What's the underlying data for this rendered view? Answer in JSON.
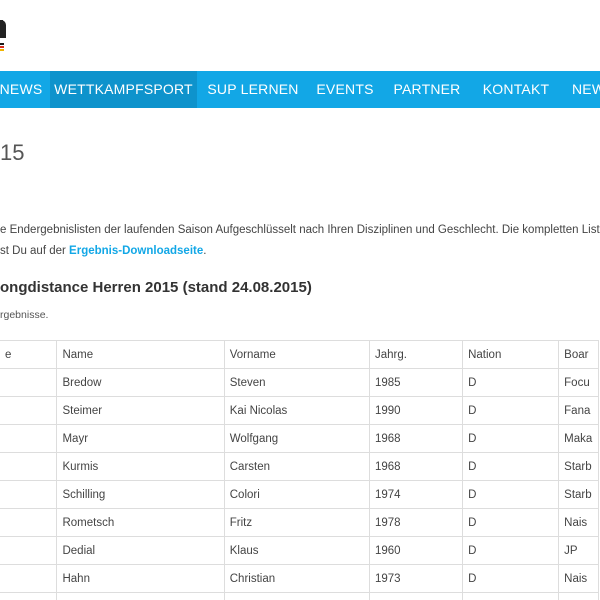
{
  "nav": {
    "items": [
      {
        "label": "NEWS"
      },
      {
        "label": "WETTKAMPFSPORT"
      },
      {
        "label": "SUP LERNEN"
      },
      {
        "label": "EVENTS"
      },
      {
        "label": "PARTNER"
      },
      {
        "label": "KONTAKT"
      },
      {
        "label": "NEW"
      }
    ]
  },
  "page": {
    "title": "15",
    "intro_line1": "e Endergebnislisten der laufenden Saison Aufgeschlüsselt nach Ihren Disziplinen und Geschlecht. Die kompletten Listen i",
    "intro_line2_prefix": "st Du auf der ",
    "intro_link": "Ergebnis-Downloadseite",
    "intro_line2_suffix": "."
  },
  "section": {
    "title_bold": "ongdistance Herren 2015",
    "title_suffix": " (stand 24.08.2015)",
    "note": "rgebnisse."
  },
  "table": {
    "headers": [
      "e",
      "Name",
      "Vorname",
      "Jahrg.",
      "Nation",
      "Boar"
    ],
    "rows": [
      [
        "",
        "Bredow",
        "Steven",
        "1985",
        "D",
        "Focu"
      ],
      [
        "",
        "Steimer",
        "Kai Nicolas",
        "1990",
        "D",
        "Fana"
      ],
      [
        "",
        "Mayr",
        "Wolfgang",
        "1968",
        "D",
        "Maka"
      ],
      [
        "",
        "Kurmis",
        "Carsten",
        "1968",
        "D",
        "Starb"
      ],
      [
        "",
        "Schilling",
        "Colori",
        "1974",
        "D",
        "Starb"
      ],
      [
        "",
        "Rometsch",
        "Fritz",
        "1978",
        "D",
        "Nais"
      ],
      [
        "",
        "Dedial",
        "Klaus",
        "1960",
        "D",
        "JP"
      ],
      [
        "",
        "Hahn",
        "Christian",
        "1973",
        "D",
        "Nais"
      ],
      [
        "",
        "",
        "",
        "",
        "",
        ""
      ]
    ]
  }
}
